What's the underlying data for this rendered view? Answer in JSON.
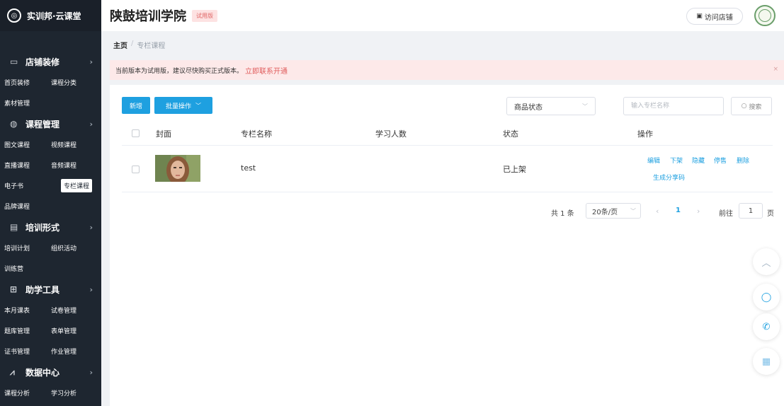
{
  "sidebar": {
    "logo_text": "实训邦·云课堂",
    "groups": [
      {
        "label": "店铺装修",
        "icon": "store-icon",
        "items": [
          [
            "首页装修",
            "课程分类"
          ],
          [
            "素材管理"
          ]
        ]
      },
      {
        "label": "课程管理",
        "icon": "course-icon",
        "items": [
          [
            "图文课程",
            "视频课程"
          ],
          [
            "直播课程",
            "音频课程"
          ],
          [
            "电子书",
            "专栏课程"
          ],
          [
            "品牌课程"
          ]
        ]
      },
      {
        "label": "培训形式",
        "icon": "training-icon",
        "items": [
          [
            "培训计划",
            "组织活动"
          ],
          [
            "训练营"
          ]
        ]
      },
      {
        "label": "助学工具",
        "icon": "tools-icon",
        "items": [
          [
            "本月课表",
            "试卷管理"
          ],
          [
            "题库管理",
            "表单管理"
          ],
          [
            "证书管理",
            "作业管理"
          ]
        ]
      },
      {
        "label": "数据中心",
        "icon": "data-icon",
        "items": [
          [
            "课程分析",
            "学习分析"
          ]
        ]
      }
    ],
    "active_item": "专栏课程"
  },
  "header": {
    "title": "陕鼓培训学院",
    "badge": "试用版",
    "visit_store": "访问店铺"
  },
  "breadcrumb": {
    "home": "主页",
    "separator": "/",
    "current": "专栏课程"
  },
  "alert": {
    "text": "当前版本为试用版，建议尽快购买正式版本。",
    "link": "立即联系开通",
    "close": "×"
  },
  "toolbar": {
    "new_label": "新增",
    "batch_label": "批量操作",
    "status_select": "商品状态",
    "search_placeholder": "输入专栏名称",
    "search_label": "搜索"
  },
  "table": {
    "headers": {
      "cover": "封面",
      "name": "专栏名称",
      "learners": "学习人数",
      "status": "状态",
      "actions": "操作"
    },
    "rows": [
      {
        "name": "test",
        "learners": "",
        "status": "已上架",
        "actions": {
          "edit": "编辑",
          "unlist": "下架",
          "hide": "隐藏",
          "stop_sale": "停售",
          "delete": "删除",
          "share_code": "生成分享码"
        }
      }
    ]
  },
  "pagination": {
    "total": "共 1 条",
    "page_size": "20条/页",
    "current": "1",
    "goto": "前往",
    "goto_value": "1",
    "page_unit": "页"
  },
  "floating": {
    "top": "︿"
  },
  "colors": {
    "primary": "#1ea0e0",
    "sidebar_bg": "#1e2630",
    "alert_bg": "#fde9e9",
    "alert_link": "#e05d5d"
  }
}
